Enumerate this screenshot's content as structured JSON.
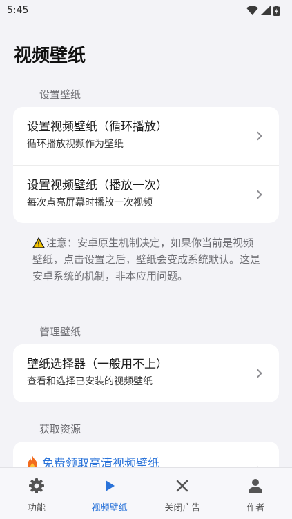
{
  "status_bar": {
    "time": "5:45"
  },
  "page": {
    "title": "视频壁纸"
  },
  "sections": {
    "set": {
      "label": "设置壁纸",
      "items": [
        {
          "title": "设置视频壁纸（循环播放）",
          "subtitle": "循环播放视频作为壁纸"
        },
        {
          "title": "设置视频壁纸（播放一次）",
          "subtitle": "每次点亮屏幕时播放一次视频"
        }
      ]
    },
    "notice": "注意：安卓原生机制决定，如果你当前是视频壁纸，点击设置之后，壁纸会变成系统默认。这是安卓系统的机制，非本应用问题。",
    "manage": {
      "label": "管理壁纸",
      "items": [
        {
          "title": "壁纸选择器（一般用不上）",
          "subtitle": "查看和选择已安装的视频壁纸"
        }
      ]
    },
    "resources": {
      "label": "获取资源",
      "items": [
        {
          "title": "免费领取高清视频壁纸"
        }
      ]
    }
  },
  "bottom_nav": {
    "items": [
      {
        "label": "功能",
        "icon": "gear-icon"
      },
      {
        "label": "视频壁纸",
        "icon": "play-icon",
        "active": true
      },
      {
        "label": "关闭广告",
        "icon": "close-icon"
      },
      {
        "label": "作者",
        "icon": "person-icon"
      }
    ]
  },
  "colors": {
    "accent": "#2a73d9",
    "background": "#f3f3f7",
    "card": "#ffffff",
    "secondary_text": "#6f6f74"
  }
}
